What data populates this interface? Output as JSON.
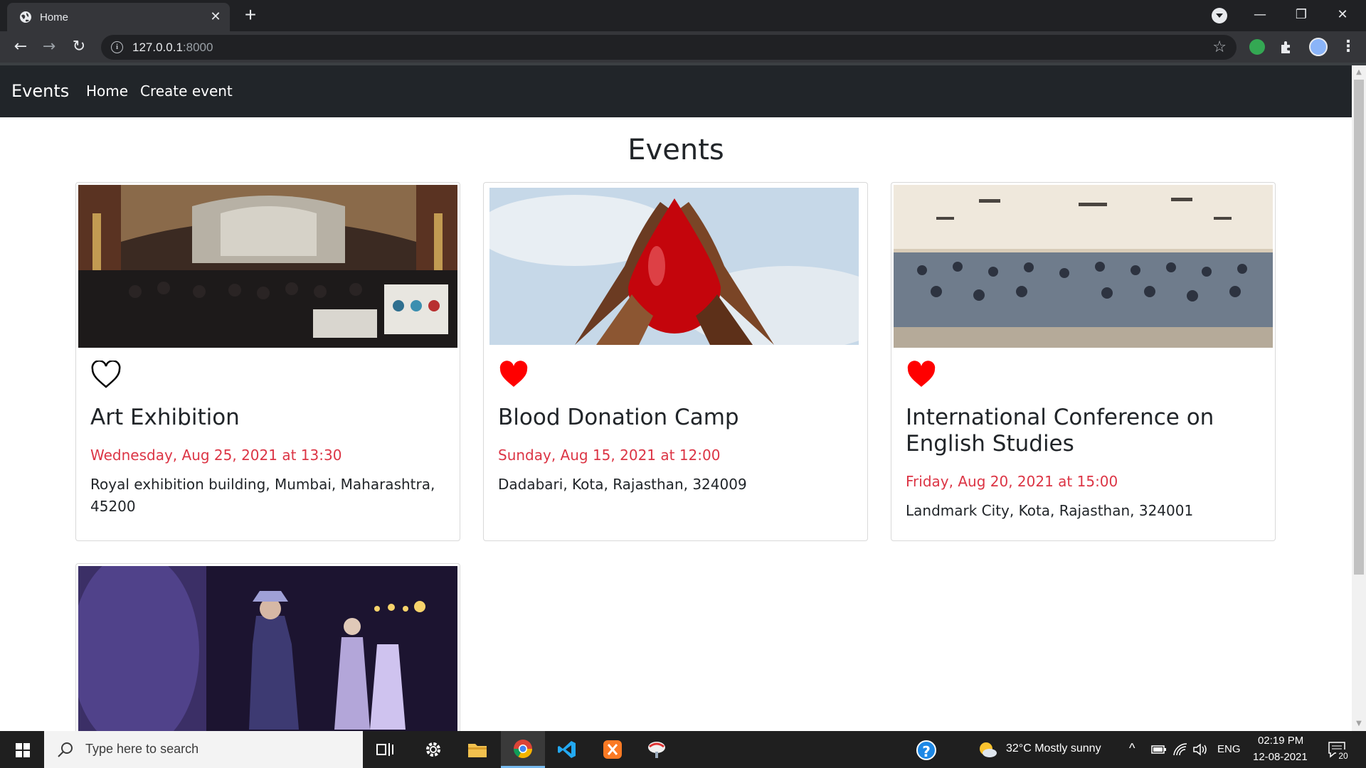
{
  "browser": {
    "tab_title": "Home",
    "tab_close": "✕",
    "new_tab": "+",
    "url_host": "127.0.0.1",
    "url_port": ":8000",
    "window_controls": {
      "minimize": "—",
      "restore": "❐",
      "close": "✕"
    }
  },
  "navbar": {
    "brand": "Events",
    "links": [
      "Home",
      "Create event"
    ]
  },
  "page": {
    "title": "Events",
    "events": [
      {
        "title": "Art Exhibition",
        "date": "Wednesday, Aug 25, 2021 at 13:30",
        "place": "Royal exhibition building, Mumbai, Maharashtra, 45200",
        "liked": false,
        "image": "exhibition-hall-photo"
      },
      {
        "title": "Blood Donation Camp",
        "date": "Sunday, Aug 15, 2021 at 12:00",
        "place": "Dadabari, Kota, Rajasthan, 324009",
        "liked": true,
        "image": "blood-drop-hands-photo"
      },
      {
        "title": "International Conference on English Studies",
        "date": "Friday, Aug 20, 2021 at 15:00",
        "place": "Landmark City, Kota, Rajasthan, 324001",
        "liked": true,
        "image": "auditorium-crowd-photo"
      },
      {
        "title": "",
        "date": "",
        "place": "",
        "liked": false,
        "image": "fashion-show-photo"
      }
    ]
  },
  "taskbar": {
    "search_placeholder": "Type here to search",
    "weather": "32°C  Mostly sunny",
    "language": "ENG",
    "time": "02:19 PM",
    "date": "12-08-2021",
    "notification_count": "20"
  },
  "colors": {
    "navbar_bg": "#212529",
    "date_red": "#dc3545",
    "heart_red": "#ff0000",
    "chrome_dark": "#202124"
  }
}
